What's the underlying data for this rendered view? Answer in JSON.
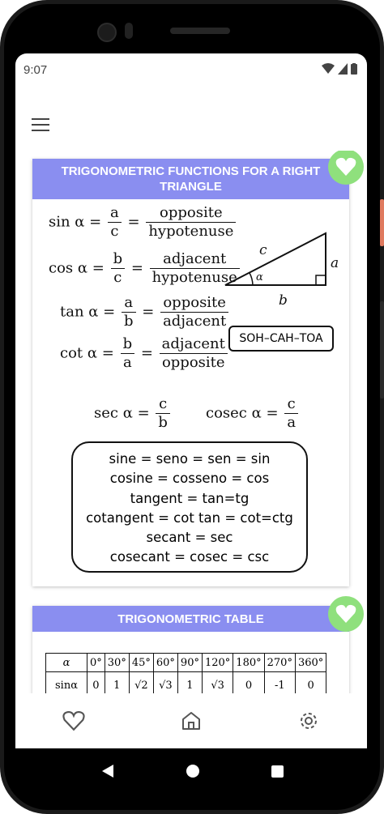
{
  "status": {
    "time": "9:07"
  },
  "card1": {
    "title": "TRIGONOMETRIC FUNCTIONS FOR A RIGHT TRIANGLE",
    "sin": {
      "lhs": "sin α =",
      "f1_num": "a",
      "f1_den": "c",
      "eq": "=",
      "f2_num": "opposite",
      "f2_den": "hypotenuse"
    },
    "cos": {
      "lhs": "cos α =",
      "f1_num": "b",
      "f1_den": "c",
      "eq": "=",
      "f2_num": "adjacent",
      "f2_den": "hypotenuse"
    },
    "tan": {
      "lhs": "tan α =",
      "f1_num": "a",
      "f1_den": "b",
      "eq": "=",
      "f2_num": "opposite",
      "f2_den": "adjacent"
    },
    "cot": {
      "lhs": "cot α =",
      "f1_num": "b",
      "f1_den": "a",
      "eq": "=",
      "f2_num": "adjacent",
      "f2_den": "opposite"
    },
    "sec": {
      "lhs": "sec α =",
      "num": "c",
      "den": "b"
    },
    "cosec": {
      "lhs": "cosec α =",
      "num": "c",
      "den": "a"
    },
    "triangle": {
      "c": "c",
      "a": "a",
      "b": "b",
      "alpha": "α"
    },
    "mnemonic": "SOH–CAH–TOA",
    "names": [
      "sine = seno = sen = sin",
      "cosine = cosseno = cos",
      "tangent = tan=tg",
      "cotangent = cot tan = cot=ctg",
      "secant = sec",
      "cosecant = cosec = csc"
    ]
  },
  "card2": {
    "title": "TRIGONOMETRIC TABLE",
    "header": [
      "α",
      "0°",
      "30°",
      "45°",
      "60°",
      "90°",
      "120°",
      "180°",
      "270°",
      "360°"
    ],
    "sin_row": [
      "sinα",
      "0",
      "1",
      "√2",
      "√3",
      "1",
      "√3",
      "0",
      "-1",
      "0"
    ]
  },
  "colors": {
    "header": "#8a8ef0",
    "fav": "#8fe07d"
  }
}
